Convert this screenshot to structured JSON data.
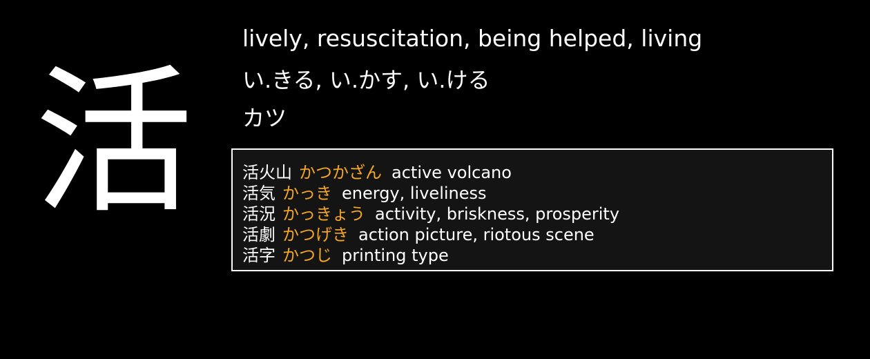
{
  "kanji": {
    "character": "活",
    "meanings": "lively, resuscitation, being helped, living",
    "kun_readings": "い.きる, い.かす, い.ける",
    "on_readings": "カツ"
  },
  "colors": {
    "background": "#000000",
    "text": "#ffffff",
    "reading_accent": "#f5a623",
    "box_background": "#141414",
    "box_border": "#ffffff"
  },
  "vocabulary": [
    {
      "word": "活火山",
      "reading": "かつかざん",
      "meaning": "active volcano"
    },
    {
      "word": "活気",
      "reading": "かっき",
      "meaning": "energy, liveliness"
    },
    {
      "word": "活況",
      "reading": "かっきょう",
      "meaning": "activity, briskness, prosperity"
    },
    {
      "word": "活劇",
      "reading": "かつげき",
      "meaning": "action picture, riotous scene"
    },
    {
      "word": "活字",
      "reading": "かつじ",
      "meaning": "printing type"
    }
  ]
}
